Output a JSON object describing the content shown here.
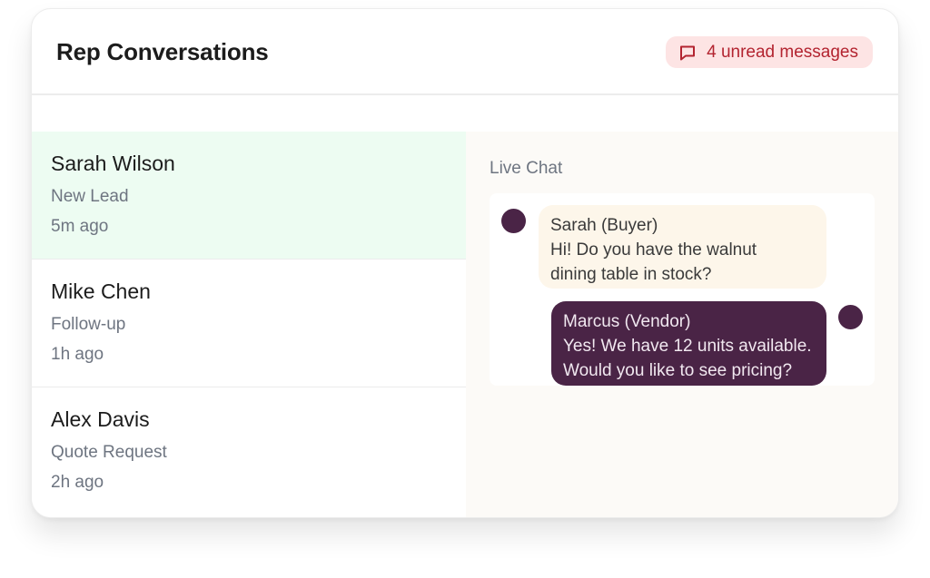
{
  "header": {
    "title": "Rep Conversations",
    "unread_badge": "4 unread messages",
    "badge_icon": "message-square-icon",
    "badge_color": "#b32430"
  },
  "conversations": [
    {
      "name": "Sarah Wilson",
      "status": "New Lead",
      "time": "5m ago",
      "active": true
    },
    {
      "name": "Mike Chen",
      "status": "Follow-up",
      "time": "1h ago",
      "active": false
    },
    {
      "name": "Alex Davis",
      "status": "Quote Request",
      "time": "2h ago",
      "active": false
    }
  ],
  "chat": {
    "label": "Live Chat",
    "messages": [
      {
        "sender": "Sarah (Buyer)",
        "line1": "Hi! Do you have the walnut",
        "line2": "dining table in stock?"
      },
      {
        "sender": "Marcus (Vendor)",
        "line1": "Yes! We have 12 units available.",
        "line2": "Would you like to see pricing?"
      }
    ]
  },
  "colors": {
    "accent_plum": "#4a2446",
    "active_row": "#edfcf2",
    "badge_bg": "#fde4e4"
  }
}
